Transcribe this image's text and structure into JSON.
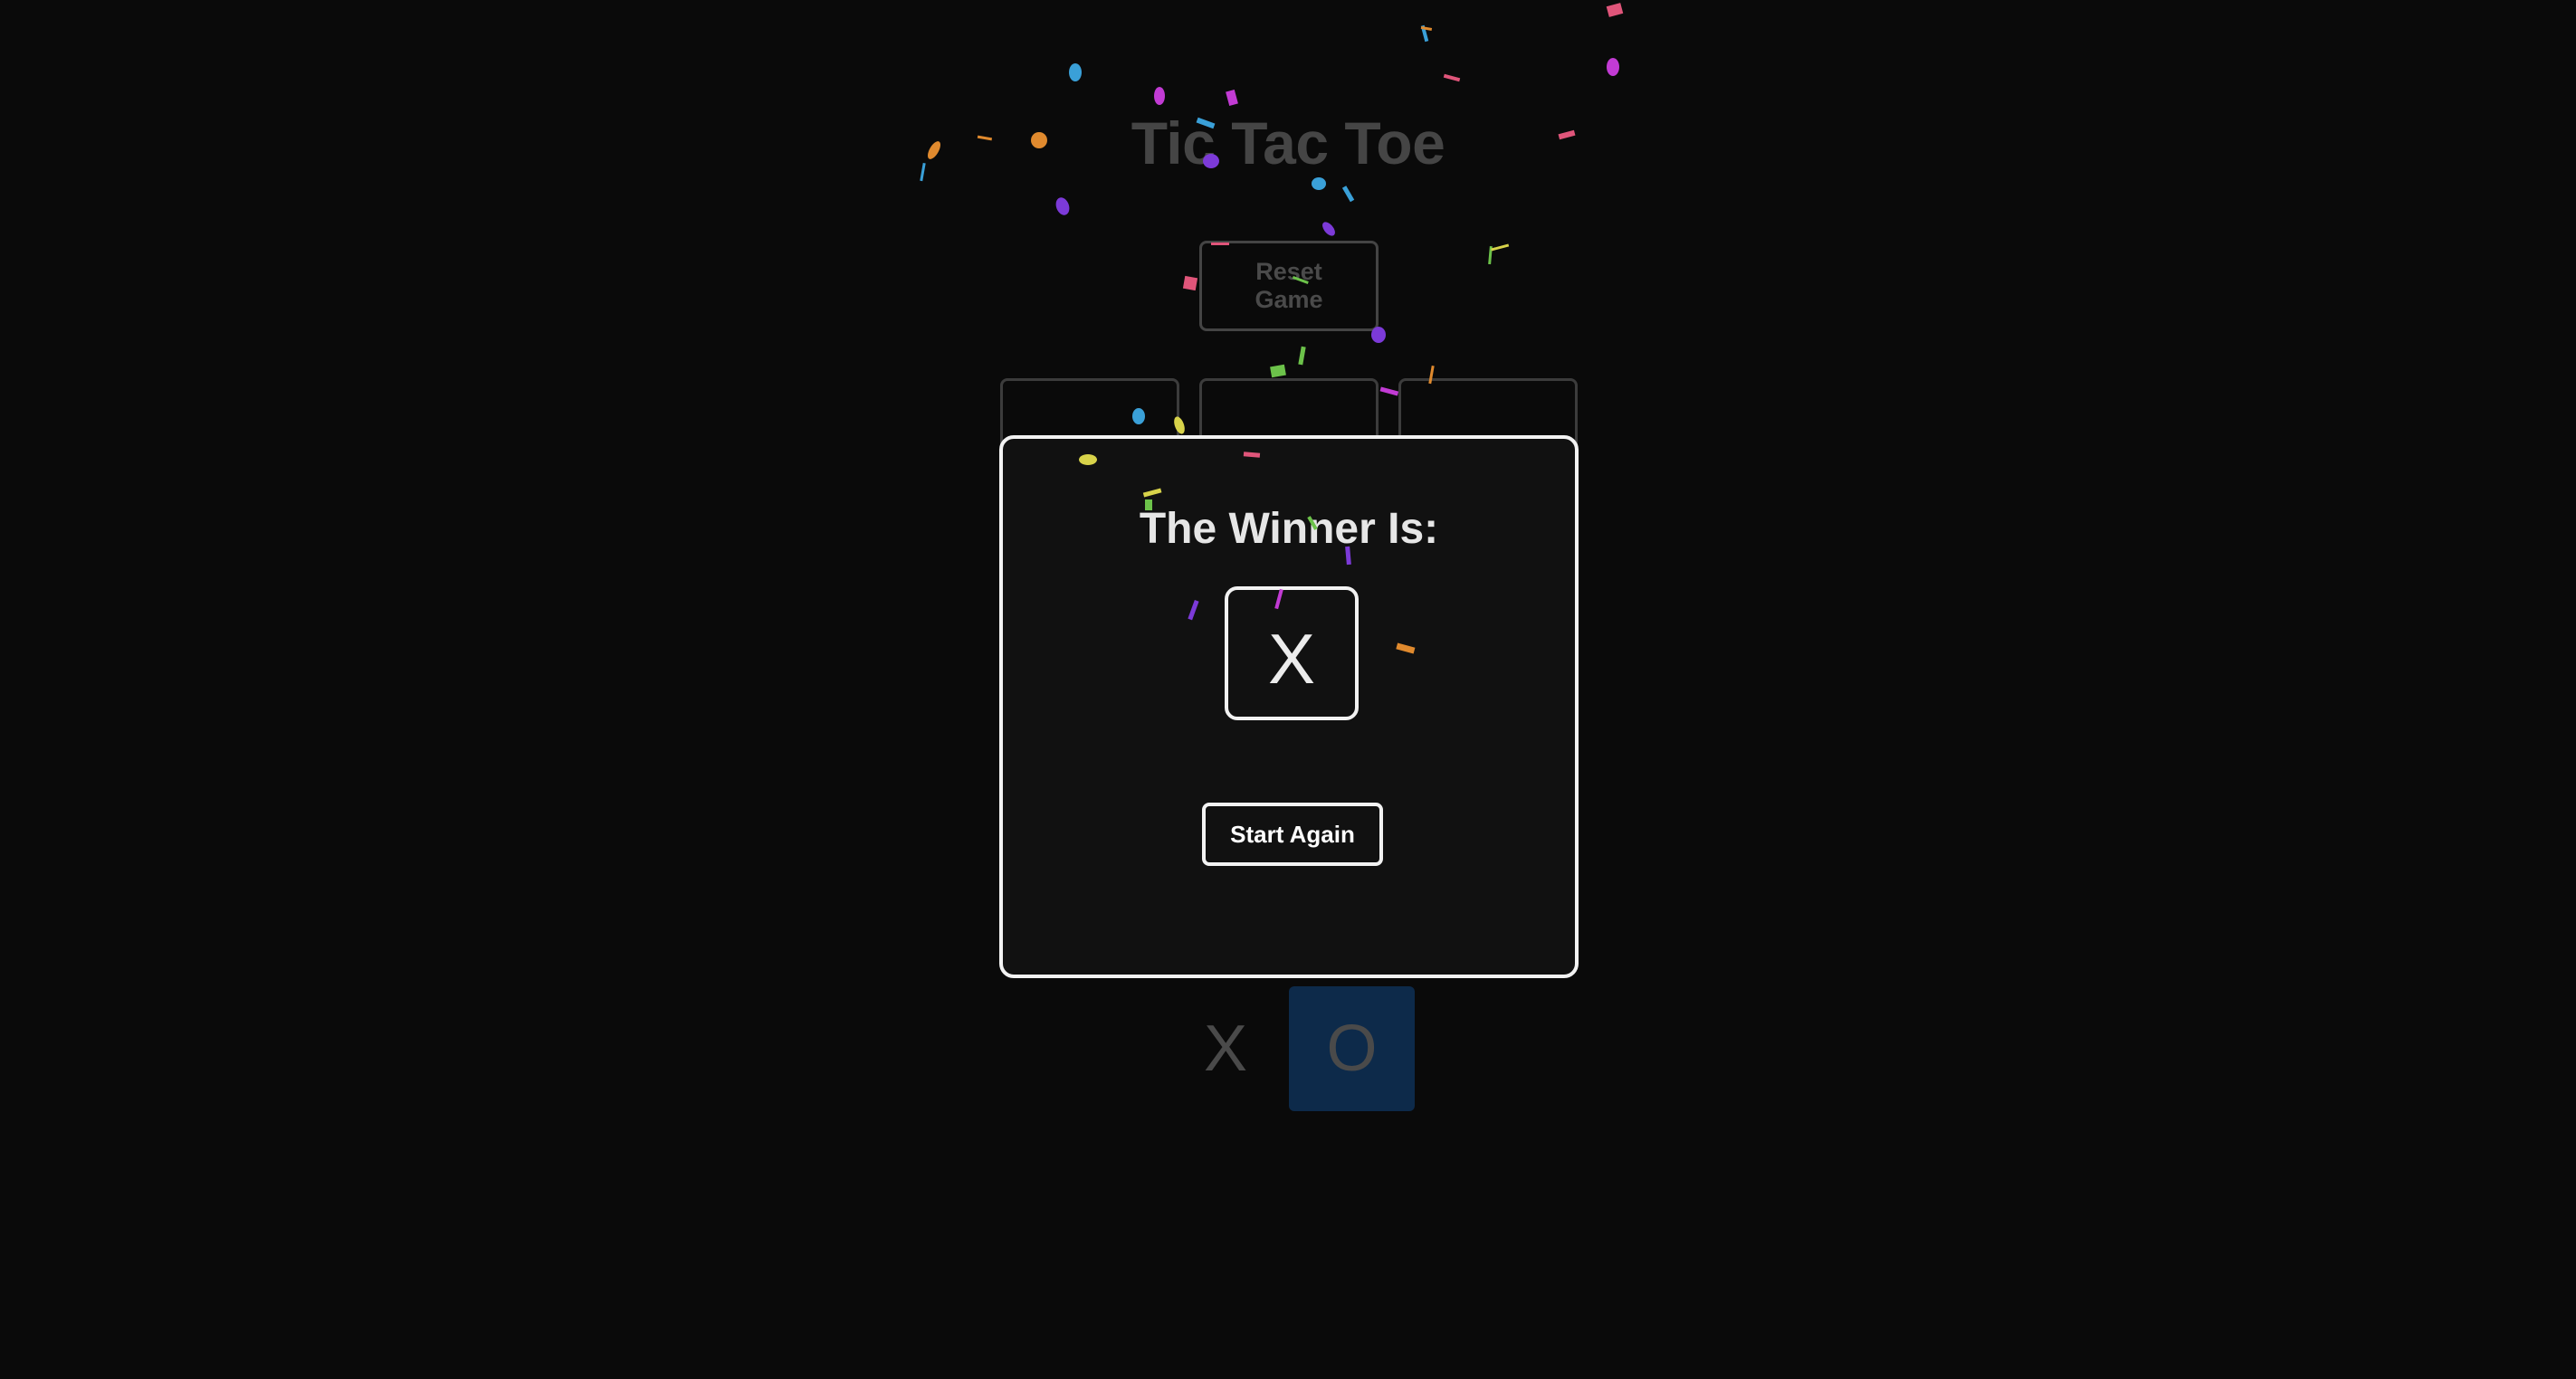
{
  "game": {
    "title": "Tic Tac Toe",
    "reset_label": "Reset Game",
    "turn_x_label": "X",
    "turn_o_label": "O",
    "board_cells": [
      "",
      "",
      ""
    ]
  },
  "modal": {
    "title": "The Winner Is:",
    "winner": "X",
    "start_again_label": "Start Again"
  },
  "colors": {
    "background": "#0a0a0a",
    "modal_border": "#f2f2f2",
    "active_turn": "#0d2a4a",
    "confetti": [
      "#e0557a",
      "#c23bd4",
      "#3aa0d8",
      "#e08a2e",
      "#7c3ad8",
      "#6cc24a",
      "#d8d34a"
    ]
  }
}
